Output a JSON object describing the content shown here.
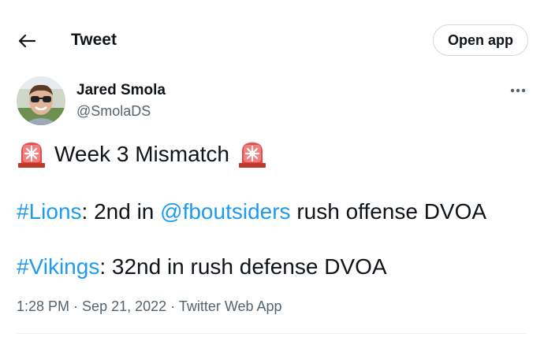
{
  "header": {
    "back_icon": "arrow-left-icon",
    "title": "Tweet",
    "open_app_label": "Open app"
  },
  "author": {
    "name": "Jared Smola",
    "handle": "@SmolaDS",
    "more_icon": "more-horizontal-icon"
  },
  "tweet": {
    "line1": {
      "emoji_icon": "police-light-icon",
      "text": "Week 3 Mismatch"
    },
    "line2": {
      "hashtag": "#Lions",
      "text_a": ": 2nd in ",
      "mention": "@fboutsiders",
      "text_b": " rush offense DVOA"
    },
    "line3": {
      "hashtag": "#Vikings",
      "text_a": ": 32nd in rush defense DVOA"
    }
  },
  "meta": {
    "time": "1:28 PM",
    "sep1": " · ",
    "date": "Sep 21, 2022",
    "sep2": " · ",
    "source": "Twitter Web App"
  },
  "colors": {
    "link": "#1d9bf0",
    "secondary_text": "#536471",
    "primary_text": "#0f1419"
  }
}
